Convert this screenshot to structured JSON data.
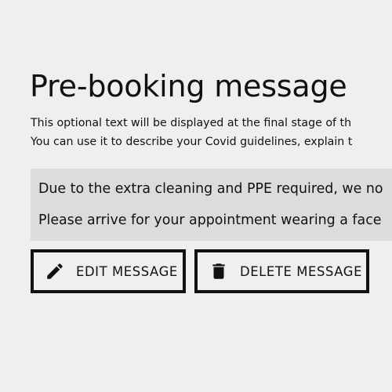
{
  "page": {
    "title": "Pre-booking message",
    "description": [
      "This optional text will be displayed at the final stage of th",
      "You can use it to describe your Covid guidelines, explain t"
    ]
  },
  "message": {
    "lines": [
      "Due to the extra cleaning and PPE required, we no",
      "Please arrive for your appointment wearing a face"
    ]
  },
  "actions": {
    "edit": {
      "label": "EDIT MESSAGE",
      "icon": "pencil-icon"
    },
    "delete": {
      "label": "DELETE MESSAGE",
      "icon": "trash-icon"
    }
  },
  "colors": {
    "background": "#efefef",
    "message_box": "#dcdcdc",
    "text": "#111111"
  }
}
